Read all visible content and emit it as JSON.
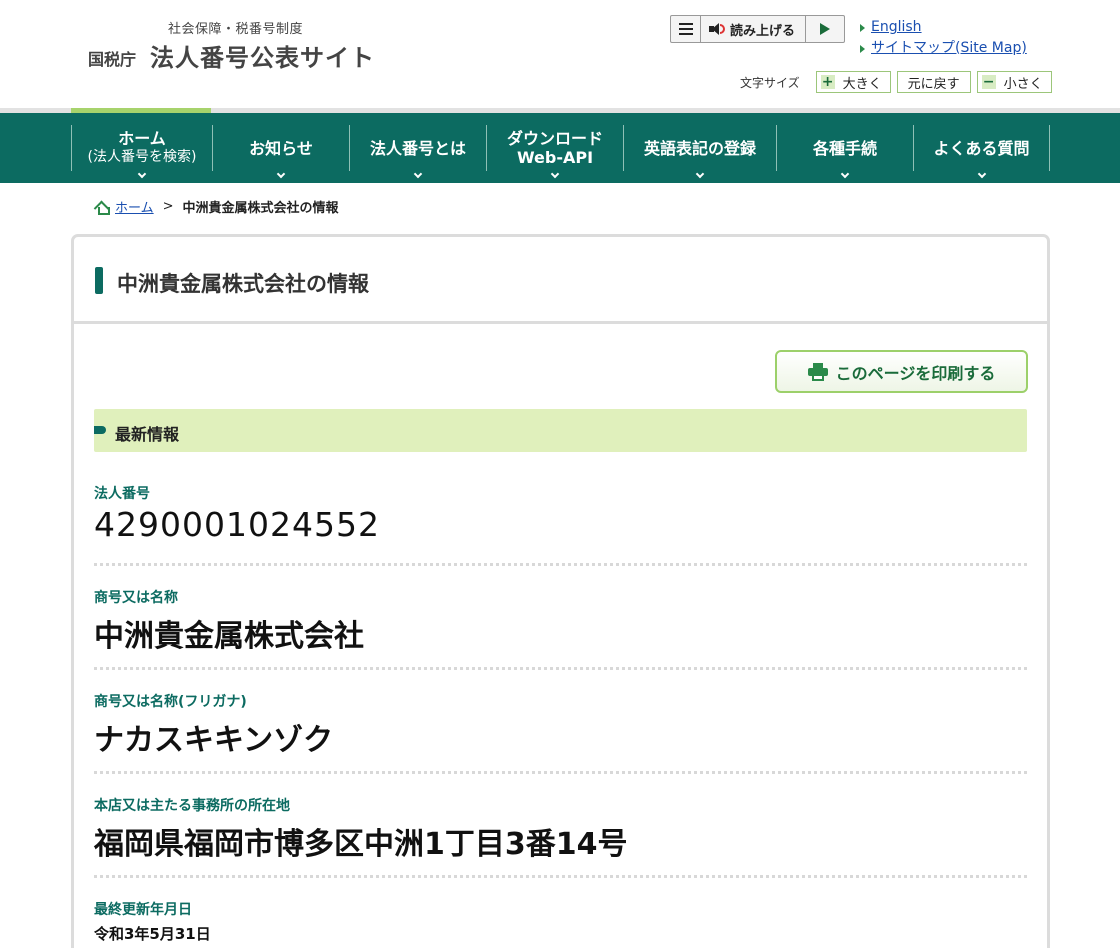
{
  "header": {
    "logo_sub": "社会保障・税番号制度",
    "logo_agency": "国税庁",
    "logo_title": "法人番号公表サイト",
    "read_aloud_label": "読み上げる",
    "links": [
      {
        "label": "English"
      },
      {
        "label": "サイトマップ(Site Map)"
      }
    ],
    "font_size": {
      "label": "文字サイズ",
      "larger_symbol": "+",
      "larger": "大きく",
      "reset": "元に戻す",
      "smaller_symbol": "−",
      "smaller": "小さく"
    }
  },
  "nav": {
    "items": [
      {
        "line1": "ホーム",
        "line2": "(法人番号を検索)",
        "has_dropdown": false,
        "active": true
      },
      {
        "line1": "お知らせ",
        "has_dropdown": true
      },
      {
        "line1": "法人番号とは",
        "has_dropdown": true
      },
      {
        "line1": "ダウンロード",
        "line2": "Web-API",
        "has_dropdown": true
      },
      {
        "line1": "英語表記の登録",
        "has_dropdown": true
      },
      {
        "line1": "各種手続",
        "has_dropdown": true
      },
      {
        "line1": "よくある質問",
        "has_dropdown": true
      }
    ]
  },
  "breadcrumb": {
    "home": "ホーム",
    "separator": ">",
    "current": "中洲貴金属株式会社の情報"
  },
  "page": {
    "title": "中洲貴金属株式会社の情報",
    "print_label": "このページを印刷する",
    "section_title": "最新情報",
    "fields": [
      {
        "label": "法人番号",
        "value": "4290001024552"
      },
      {
        "label": "商号又は名称",
        "value": "中洲貴金属株式会社"
      },
      {
        "label": "商号又は名称(フリガナ)",
        "value": "ナカスキキンゾク"
      },
      {
        "label": "本店又は主たる事務所の所在地",
        "value": "福岡県福岡市博多区中洲1丁目3番14号"
      },
      {
        "label": "最終更新年月日",
        "value": "令和3年5月31日"
      }
    ]
  },
  "colors": {
    "nav_bg": "#0c6b61",
    "accent_green": "#a7d36c",
    "section_bg": "#e0f0bc",
    "label_green": "#0c6b61",
    "link_blue": "#1a4fb0"
  }
}
